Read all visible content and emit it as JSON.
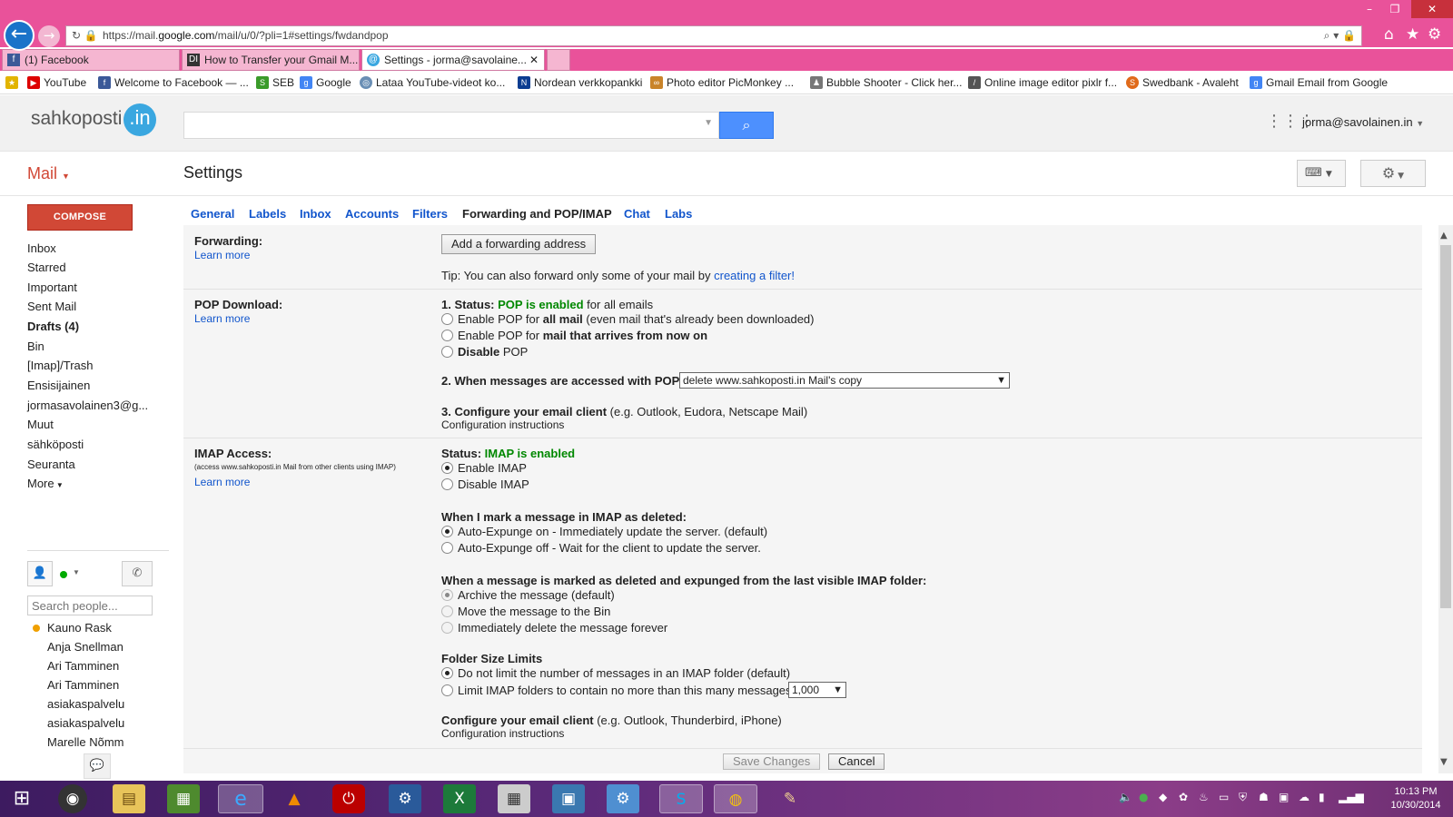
{
  "browser": {
    "url_prefix": "https://mail.",
    "url_host": "google.com",
    "url_path": "/mail/u/0/?pli=1#settings/fwdandpop",
    "tabs": [
      {
        "label": "(1) Facebook"
      },
      {
        "label": "How to Transfer your Gmail M..."
      },
      {
        "label": "Settings - jorma@savolaine..."
      }
    ],
    "bookmarks": [
      {
        "label": "YouTube"
      },
      {
        "label": "Welcome to Facebook — ..."
      },
      {
        "label": "SEB"
      },
      {
        "label": "Google"
      },
      {
        "label": "Lataa YouTube-videot ko..."
      },
      {
        "label": "Nordean verkkopankki"
      },
      {
        "label": "Photo editor  PicMonkey ..."
      },
      {
        "label": "Bubble Shooter - Click her..."
      },
      {
        "label": "Online image editor pixlr f..."
      },
      {
        "label": "Swedbank - Avaleht"
      },
      {
        "label": "Gmail Email from Google"
      }
    ]
  },
  "header": {
    "logo_text": "sahkoposti",
    "logo_badge": ".in",
    "account": "jorma@savolainen.in"
  },
  "toolbar": {
    "mail_label": "Mail",
    "settings_title": "Settings"
  },
  "sidebar": {
    "compose": "COMPOSE",
    "items": [
      {
        "label": "Inbox"
      },
      {
        "label": "Starred"
      },
      {
        "label": "Important"
      },
      {
        "label": "Sent Mail"
      },
      {
        "label": "Drafts (4)"
      },
      {
        "label": "Bin"
      },
      {
        "label": "[Imap]/Trash"
      },
      {
        "label": "Ensisijainen"
      },
      {
        "label": "jormasavolainen3@g..."
      },
      {
        "label": "Muut"
      },
      {
        "label": "sähköposti"
      },
      {
        "label": "Seuranta"
      },
      {
        "label": "More"
      }
    ],
    "search_people_placeholder": "Search people...",
    "contacts": [
      {
        "name": "Kauno Rask"
      },
      {
        "name": "Anja Snellman"
      },
      {
        "name": "Ari Tamminen"
      },
      {
        "name": "Ari Tamminen"
      },
      {
        "name": "asiakaspalvelu"
      },
      {
        "name": "asiakaspalvelu"
      },
      {
        "name": "Marelle Nõmm"
      }
    ]
  },
  "settings_tabs": [
    {
      "label": "General"
    },
    {
      "label": "Labels"
    },
    {
      "label": "Inbox"
    },
    {
      "label": "Accounts"
    },
    {
      "label": "Filters"
    },
    {
      "label": "Forwarding and POP/IMAP"
    },
    {
      "label": "Chat"
    },
    {
      "label": "Labs"
    }
  ],
  "forwarding": {
    "label": "Forwarding:",
    "learn_more": "Learn more",
    "add_button": "Add a forwarding address",
    "tip_prefix": "Tip: You can also forward only some of your mail by ",
    "tip_link": "creating a filter!"
  },
  "pop": {
    "label": "POP Download:",
    "learn_more": "Learn more",
    "status_prefix": "1. Status: ",
    "status_value": "POP is enabled",
    "status_suffix": " for all emails",
    "opt1_a": "Enable POP for ",
    "opt1_b": "all mail",
    "opt1_c": " (even mail that's already been downloaded)",
    "opt2_a": "Enable POP for ",
    "opt2_b": "mail that arrives from now on",
    "opt3_a": "Disable",
    "opt3_b": " POP",
    "step2": "2. When messages are accessed with POP",
    "step2_select": "delete www.sahkoposti.in Mail's copy",
    "step3": "3. Configure your email client",
    "step3_suffix": " (e.g. Outlook, Eudora, Netscape Mail)",
    "config_link": "Configuration instructions"
  },
  "imap": {
    "label": "IMAP Access:",
    "note": "(access www.sahkoposti.in Mail from other clients using IMAP)",
    "learn_more": "Learn more",
    "status_prefix": "Status: ",
    "status_value": "IMAP is enabled",
    "enable": "Enable IMAP",
    "disable": "Disable IMAP",
    "deleted_heading": "When I mark a message in IMAP as deleted:",
    "expunge_on": "Auto-Expunge on - Immediately update the server. (default)",
    "expunge_off": "Auto-Expunge off - Wait for the client to update the server.",
    "expunged_heading": "When a message is marked as deleted and expunged from the last visible IMAP folder:",
    "archive": "Archive the message (default)",
    "move_bin": "Move the message to the Bin",
    "delete_forever": "Immediately delete the message forever",
    "folder_heading": "Folder Size Limits",
    "no_limit": "Do not limit the number of messages in an IMAP folder (default)",
    "limit": "Limit IMAP folders to contain no more than this many messages",
    "limit_select": "1,000",
    "config_heading": "Configure your email client",
    "config_suffix": " (e.g. Outlook, Thunderbird, iPhone)",
    "config_link": "Configuration instructions"
  },
  "actions": {
    "save": "Save Changes",
    "cancel": "Cancel"
  },
  "taskbar": {
    "time": "10:13 PM",
    "date": "10/30/2014"
  }
}
